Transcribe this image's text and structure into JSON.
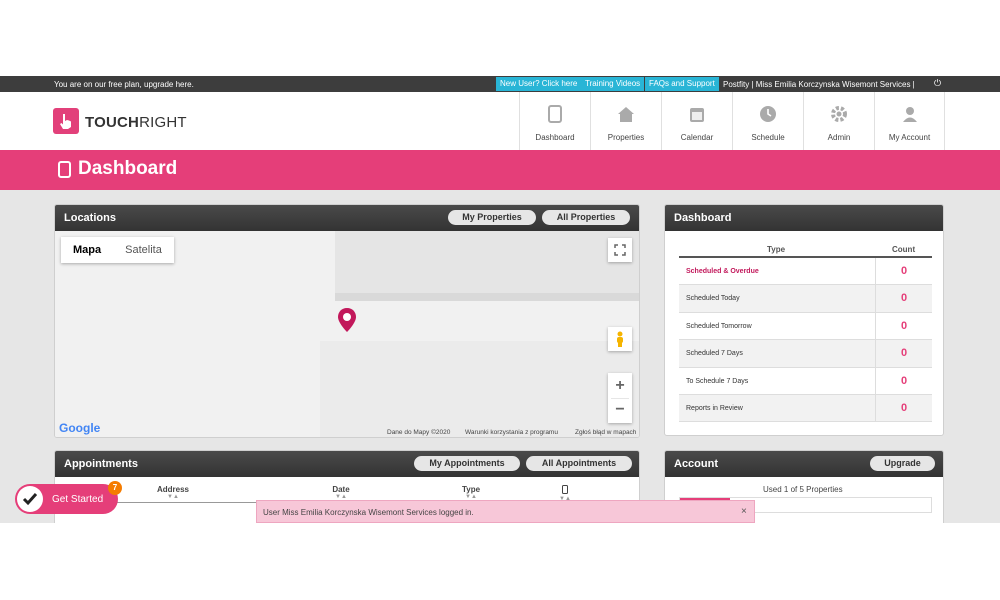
{
  "topbar": {
    "upgrade_text": "You are on our free plan, upgrade here.",
    "new_user_label": "New User? Click here",
    "training_label": "Training Videos",
    "faq_label": "FAQs and Support",
    "user_text": "Postfity | Miss Emilia Korczynska Wisemont Services |",
    "power_icon": "⏻"
  },
  "brand": {
    "name_bold": "TOUCH",
    "name_light": "RIGHT"
  },
  "nav": [
    {
      "label": "Dashboard",
      "icon": "tablet-icon"
    },
    {
      "label": "Properties",
      "icon": "house-icon"
    },
    {
      "label": "Calendar",
      "icon": "calendar-icon"
    },
    {
      "label": "Schedule",
      "icon": "clock-icon"
    },
    {
      "label": "Admin",
      "icon": "gear-icon"
    },
    {
      "label": "My Account",
      "icon": "user-icon"
    }
  ],
  "page": {
    "title": "Dashboard"
  },
  "locations": {
    "title": "Locations",
    "my_properties": "My Properties",
    "all_properties": "All Properties",
    "map_type_map": "Mapa",
    "map_type_satellite": "Satelita",
    "google": "Google",
    "footer_data": "Dane do Mapy ©2020",
    "footer_terms": "Warunki korzystania z programu",
    "footer_report": "Zgłoś błąd w mapach"
  },
  "dashboard": {
    "title": "Dashboard",
    "col_type": "Type",
    "col_count": "Count",
    "rows": [
      {
        "type": "Scheduled & Overdue",
        "count": "0"
      },
      {
        "type": "Scheduled Today",
        "count": "0"
      },
      {
        "type": "Scheduled Tomorrow",
        "count": "0"
      },
      {
        "type": "Scheduled 7 Days",
        "count": "0"
      },
      {
        "type": "To Schedule 7 Days",
        "count": "0"
      },
      {
        "type": "Reports in Review",
        "count": "0"
      }
    ]
  },
  "appointments": {
    "title": "Appointments",
    "my_appointments": "My Appointments",
    "all_appointments": "All Appointments",
    "col_address": "Address",
    "col_date": "Date",
    "col_type": "Type",
    "sort_glyph": "▼▲"
  },
  "account": {
    "title": "Account",
    "upgrade": "Upgrade",
    "used_text": "Used 1 of 5 Properties",
    "used_fraction": 0.2
  },
  "get_started": {
    "label": "Get Started",
    "badge": "7"
  },
  "toast": {
    "message": "User Miss Emilia Korczynska Wisemont Services logged in.",
    "close": "×"
  },
  "colors": {
    "accent": "#e53e79",
    "info": "#29b5d6",
    "dark": "#3d3d3d"
  }
}
